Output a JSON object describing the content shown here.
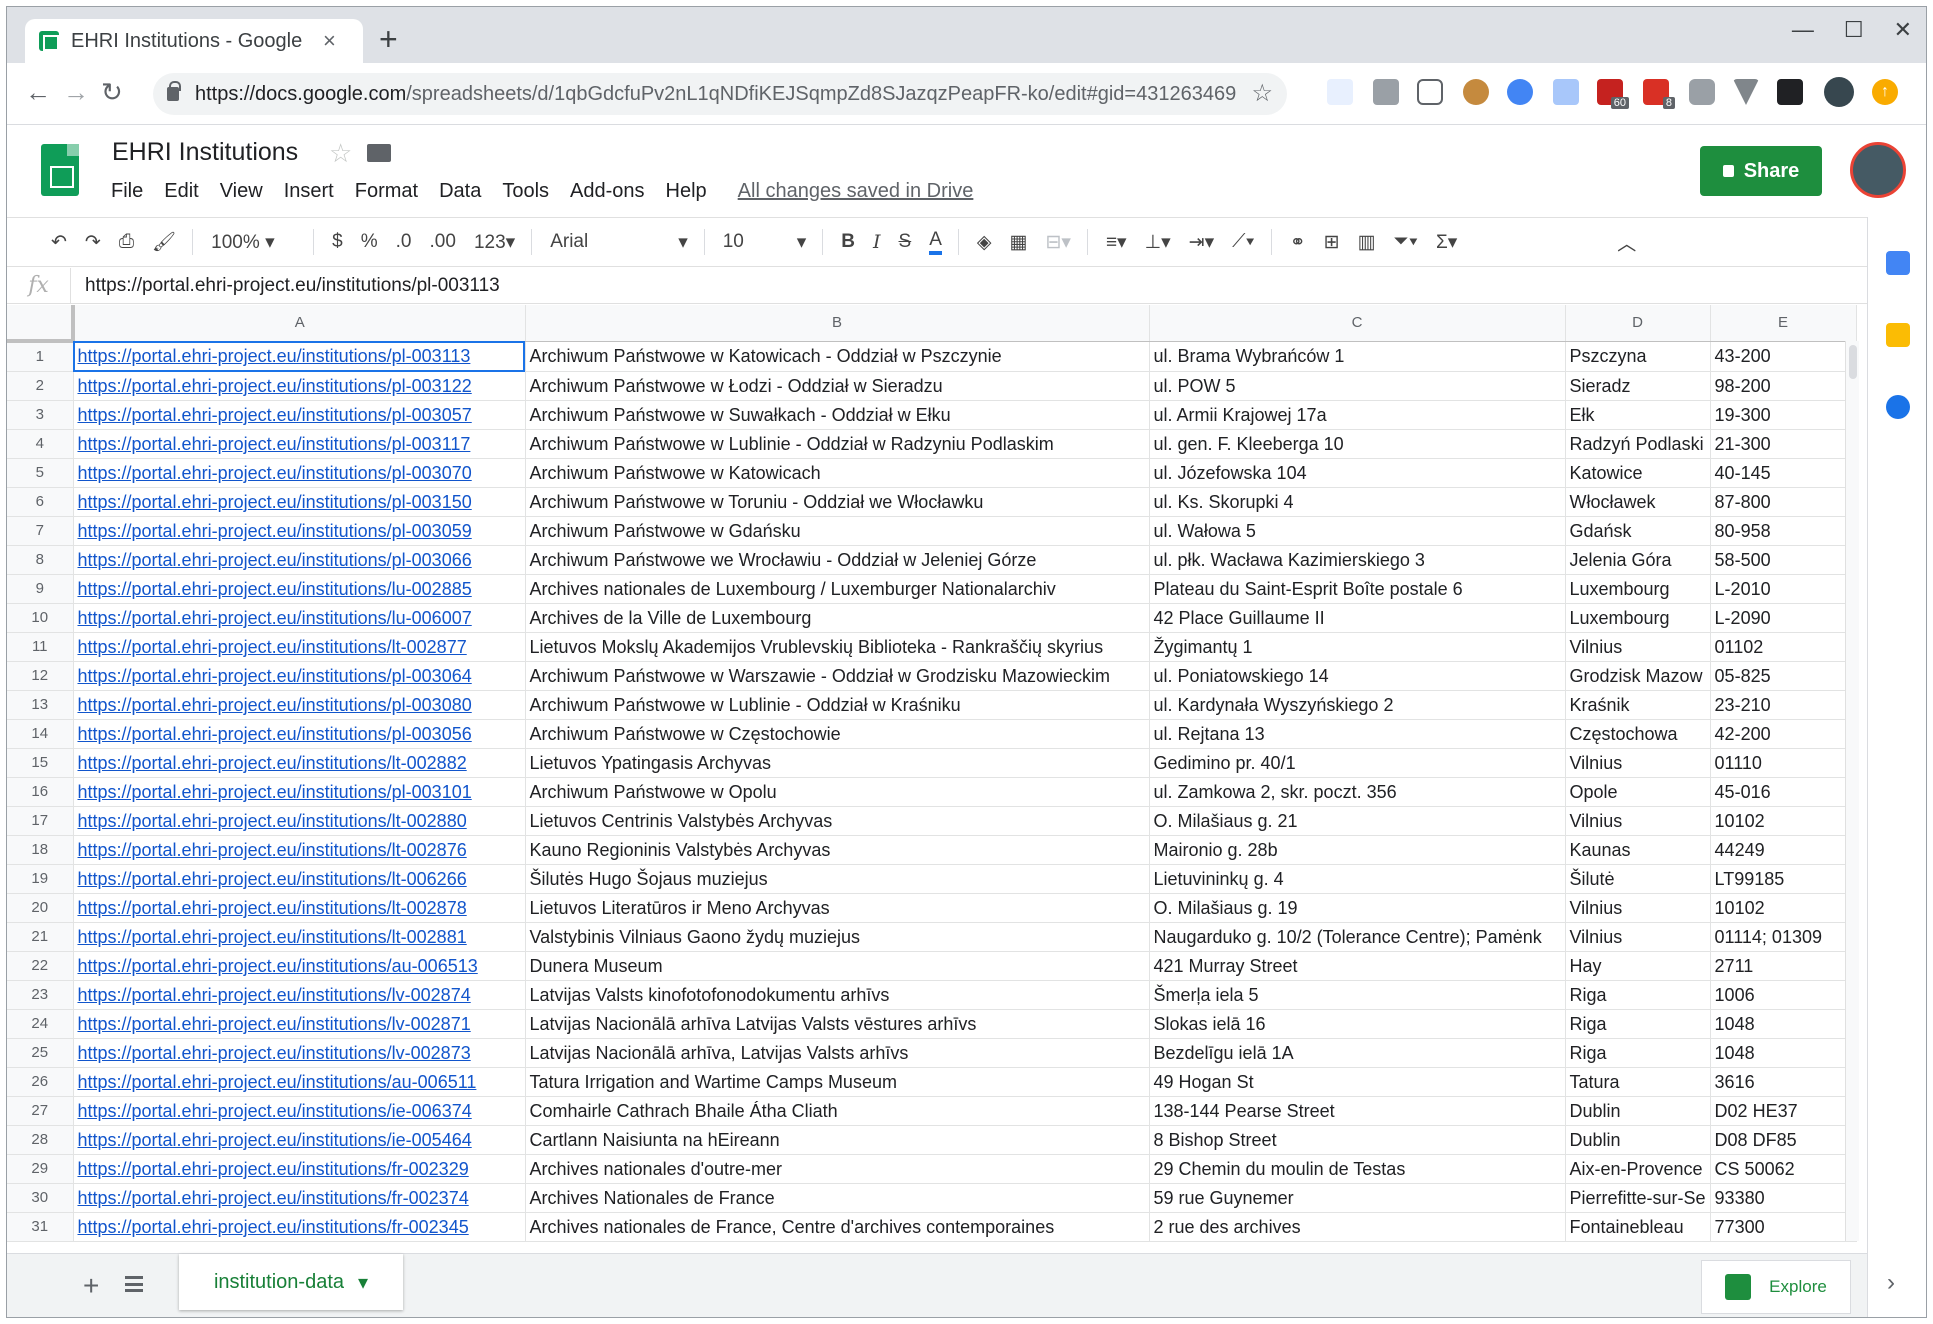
{
  "browser": {
    "tab_title": "EHRI Institutions - Google",
    "tab_close": "×",
    "new_tab": "+",
    "window_controls": [
      "—",
      "☐",
      "✕"
    ],
    "url_host": "https://docs.google.com",
    "url_path": "/spreadsheets/d/1qbGdcfuPv2nL1qNDfiKEJSqmpZd8SJazqzPeapFR-ko/edit#gid=431263469",
    "nav": {
      "back": "←",
      "forward": "→",
      "reload": "↻"
    },
    "extension_badges": [
      "60",
      "8"
    ]
  },
  "doc": {
    "title": "EHRI Institutions",
    "menu": [
      "File",
      "Edit",
      "View",
      "Insert",
      "Format",
      "Data",
      "Tools",
      "Add-ons",
      "Help"
    ],
    "saved_status": "All changes saved in Drive",
    "share_label": "Share"
  },
  "toolbar": {
    "undo": "↶",
    "redo": "↷",
    "print": "⎙",
    "paint": "🖌",
    "zoom": "100%",
    "currency": "$",
    "percent": "%",
    "dec_less": ".0",
    "dec_more": ".00",
    "more_formats": "123",
    "font": "Arial",
    "font_size": "10",
    "bold": "B",
    "italic": "I",
    "strike": "S",
    "text_color": "A",
    "sum": "Σ",
    "collapse": "︿"
  },
  "formula": {
    "fx": "fx",
    "value": "https://portal.ehri-project.eu/institutions/pl-003113"
  },
  "columns": [
    "A",
    "B",
    "C",
    "D",
    "E"
  ],
  "rows": [
    [
      "1",
      "https://portal.ehri-project.eu/institutions/pl-003113",
      "Archiwum Państwowe w Katowicach - Oddział w Pszczynie",
      "ul. Brama Wybrańców 1",
      "Pszczyna",
      "43-200"
    ],
    [
      "2",
      "https://portal.ehri-project.eu/institutions/pl-003122",
      "Archiwum Państwowe w Łodzi - Oddział w Sieradzu",
      "ul. POW 5",
      "Sieradz",
      "98-200"
    ],
    [
      "3",
      "https://portal.ehri-project.eu/institutions/pl-003057",
      "Archiwum Państwowe w Suwałkach - Oddział w Ełku",
      "ul. Armii Krajowej 17a",
      "Ełk",
      "19-300"
    ],
    [
      "4",
      "https://portal.ehri-project.eu/institutions/pl-003117",
      "Archiwum Państwowe w Lublinie - Oddział w Radzyniu Podlaskim",
      "ul. gen. F. Kleeberga 10",
      "Radzyń Podlaski",
      "21-300"
    ],
    [
      "5",
      "https://portal.ehri-project.eu/institutions/pl-003070",
      "Archiwum Państwowe w Katowicach",
      "ul. Józefowska 104",
      "Katowice",
      "40-145"
    ],
    [
      "6",
      "https://portal.ehri-project.eu/institutions/pl-003150",
      "Archiwum Państwowe w Toruniu - Oddział we Włocławku",
      "ul. Ks. Skorupki 4",
      "Włocławek",
      "87-800"
    ],
    [
      "7",
      "https://portal.ehri-project.eu/institutions/pl-003059",
      "Archiwum Państwowe w Gdańsku",
      "ul. Wałowa 5",
      "Gdańsk",
      "80-958"
    ],
    [
      "8",
      "https://portal.ehri-project.eu/institutions/pl-003066",
      "Archiwum Państwowe we Wrocławiu - Oddział w Jeleniej Górze",
      "ul. płk. Wacława Kazimierskiego 3",
      "Jelenia Góra",
      "58-500"
    ],
    [
      "9",
      "https://portal.ehri-project.eu/institutions/lu-002885",
      "Archives nationales de Luxembourg / Luxemburger Nationalarchiv",
      "Plateau du Saint-Esprit Boîte postale 6",
      "Luxembourg",
      "L-2010"
    ],
    [
      "10",
      "https://portal.ehri-project.eu/institutions/lu-006007",
      "Archives de la Ville de Luxembourg",
      "42 Place Guillaume II",
      "Luxembourg",
      "L-2090"
    ],
    [
      "11",
      "https://portal.ehri-project.eu/institutions/lt-002877",
      "Lietuvos Mokslų Akademijos Vrublevskių Biblioteka - Rankraščių skyrius",
      "Žygimantų 1",
      "Vilnius",
      "01102"
    ],
    [
      "12",
      "https://portal.ehri-project.eu/institutions/pl-003064",
      "Archiwum Państwowe w Warszawie - Oddział w Grodzisku Mazowieckim",
      "ul. Poniatowskiego 14",
      "Grodzisk Mazow",
      "05-825"
    ],
    [
      "13",
      "https://portal.ehri-project.eu/institutions/pl-003080",
      "Archiwum Państwowe w Lublinie - Oddział w Kraśniku",
      "ul. Kardynała Wyszyńskiego 2",
      "Kraśnik",
      "23-210"
    ],
    [
      "14",
      "https://portal.ehri-project.eu/institutions/pl-003056",
      "Archiwum Państwowe w Częstochowie",
      "ul. Rejtana 13",
      "Częstochowa",
      "42-200"
    ],
    [
      "15",
      "https://portal.ehri-project.eu/institutions/lt-002882",
      "Lietuvos Ypatingasis Archyvas",
      "Gedimino pr. 40/1",
      "Vilnius",
      "01110"
    ],
    [
      "16",
      "https://portal.ehri-project.eu/institutions/pl-003101",
      "Archiwum Państwowe w Opolu",
      "ul. Zamkowa 2, skr. poczt. 356",
      "Opole",
      "45-016"
    ],
    [
      "17",
      "https://portal.ehri-project.eu/institutions/lt-002880",
      "Lietuvos Centrinis Valstybės Archyvas",
      "O. Milašiaus g. 21",
      "Vilnius",
      "10102"
    ],
    [
      "18",
      "https://portal.ehri-project.eu/institutions/lt-002876",
      "Kauno Regioninis Valstybės Archyvas",
      "Maironio g. 28b",
      "Kaunas",
      "44249"
    ],
    [
      "19",
      "https://portal.ehri-project.eu/institutions/lt-006266",
      "Šilutės Hugo Šojaus muziejus",
      "Lietuvininkų g. 4",
      "Šilutė",
      "LT99185"
    ],
    [
      "20",
      "https://portal.ehri-project.eu/institutions/lt-002878",
      "Lietuvos Literatūros ir Meno Archyvas",
      "O. Milašiaus g. 19",
      "Vilnius",
      "10102"
    ],
    [
      "21",
      "https://portal.ehri-project.eu/institutions/lt-002881",
      "Valstybinis Vilniaus Gaono žydų muziejus",
      "Naugarduko g. 10/2 (Tolerance Centre);     Pamėnk",
      "Vilnius",
      "01114; 01309"
    ],
    [
      "22",
      "https://portal.ehri-project.eu/institutions/au-006513",
      "Dunera Museum",
      "421 Murray Street",
      "Hay",
      "2711"
    ],
    [
      "23",
      "https://portal.ehri-project.eu/institutions/lv-002874",
      "Latvijas Valsts kinofotofonodokumentu arhīvs",
      "Šmerļa iela 5",
      "Riga",
      "1006"
    ],
    [
      "24",
      "https://portal.ehri-project.eu/institutions/lv-002871",
      " Latvijas Nacionālā arhīva Latvijas Valsts vēstures arhīvs",
      "Slokas ielā 16",
      "Riga",
      "1048"
    ],
    [
      "25",
      "https://portal.ehri-project.eu/institutions/lv-002873",
      "Latvijas Nacionālā arhīva, Latvijas Valsts arhīvs",
      "Bezdelīgu ielā 1A",
      "Riga",
      "1048"
    ],
    [
      "26",
      "https://portal.ehri-project.eu/institutions/au-006511",
      "Tatura Irrigation and Wartime Camps Museum",
      "49 Hogan St",
      "Tatura",
      "3616"
    ],
    [
      "27",
      "https://portal.ehri-project.eu/institutions/ie-006374",
      "Comhairle Cathrach Bhaile Átha Cliath",
      "138-144 Pearse Street",
      "Dublin",
      "D02 HE37"
    ],
    [
      "28",
      "https://portal.ehri-project.eu/institutions/ie-005464",
      "Cartlann Naisiunta na hEireann",
      "8 Bishop Street",
      "Dublin",
      "D08 DF85"
    ],
    [
      "29",
      "https://portal.ehri-project.eu/institutions/fr-002329",
      "Archives nationales d'outre-mer",
      "29 Chemin du moulin de Testas",
      "Aix-en-Provence",
      "CS 50062"
    ],
    [
      "30",
      "https://portal.ehri-project.eu/institutions/fr-002374",
      "Archives Nationales de France",
      "59 rue Guynemer",
      "Pierrefitte-sur-Se",
      "93380"
    ],
    [
      "31",
      "https://portal.ehri-project.eu/institutions/fr-002345",
      "Archives nationales de France, Centre d'archives contemporaines",
      "2 rue des archives",
      "Fontainebleau",
      "77300"
    ]
  ],
  "sheet": {
    "tab_name": "institution-data",
    "add": "+",
    "explore_label": "Explore",
    "side_toggle": "›"
  },
  "colors": {
    "link": "#1155cc",
    "share": "#1e8e3e",
    "sheet_tab": "#188038",
    "selection": "#1a73e8"
  }
}
